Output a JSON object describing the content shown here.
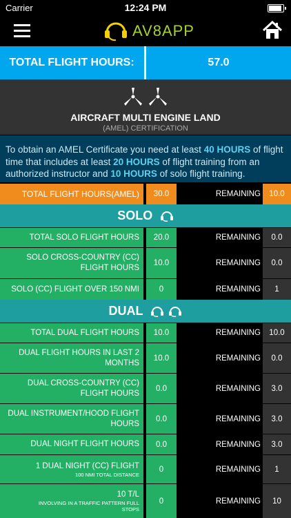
{
  "status": {
    "carrier": "Carrier",
    "time": "12:24 PM"
  },
  "app": {
    "title": "AV8APP"
  },
  "total": {
    "label": "TOTAL FLIGHT HOURS:",
    "value": "57.0"
  },
  "cert": {
    "title": "AIRCRAFT MULTI ENGINE LAND",
    "subtitle": "(AMEL) CERTIFICATION"
  },
  "desc": {
    "p1": "To obtain an AMEL Certificate you need at least ",
    "b1": "40 HOURS",
    "p2": " of flight time that includes at least ",
    "b2": "20 HOURS",
    "p3": " of flight training from an authorized instructor and ",
    "b3": "10 HOURS",
    "p4": " of solo flight training."
  },
  "amel": {
    "label": "TOTAL FLIGHT HOURS(AMEL)",
    "value": "30.0",
    "remaining_label": "REMAINING",
    "remaining": "10.0"
  },
  "solo": {
    "title": "SOLO",
    "rows": [
      {
        "label": "TOTAL SOLO FLIGHT HOURS",
        "value": "20.0",
        "remaining_label": "REMAINING",
        "remaining": "0.0"
      },
      {
        "label": "SOLO CROSS-COUNTRY (CC) FLIGHT HOURS",
        "value": "10.0",
        "remaining_label": "REMAINING",
        "remaining": "0.0"
      },
      {
        "label": "SOLO (CC) FLIGHT OVER 150 NMI",
        "value": "0",
        "remaining_label": "REMAINING",
        "remaining": "1"
      }
    ]
  },
  "dual": {
    "title": "DUAL",
    "rows": [
      {
        "label": "TOTAL DUAL FLIGHT HOURS",
        "value": "10.0",
        "remaining_label": "REMAINING",
        "remaining": "10.0"
      },
      {
        "label": "DUAL FLIGHT HOURS IN LAST 2 MONTHS",
        "value": "10.0",
        "remaining_label": "REMAINING",
        "remaining": "0.0"
      },
      {
        "label": "DUAL CROSS-COUNTRY (CC) FLIGHT HOURS",
        "value": "0.0",
        "remaining_label": "REMAINING",
        "remaining": "3.0"
      },
      {
        "label": "DUAL INSTRUMENT/HOOD FLIGHT HOURS",
        "value": "0.0",
        "remaining_label": "REMAINING",
        "remaining": "3.0"
      },
      {
        "label": "DUAL NIGHT FLIGHT HOURS",
        "value": "0.0",
        "remaining_label": "REMAINING",
        "remaining": "3.0"
      },
      {
        "label": "1 DUAL NIGHT (CC) FLIGHT",
        "sublabel": "100 NMI TOTAL DISTANCE",
        "value": "0",
        "remaining_label": "REMAINING",
        "remaining": "1"
      },
      {
        "label": "10 T/L",
        "sublabel": "INVOLVING IN A TRAFFIC PATTERN FULL STOPS",
        "value": "0",
        "remaining_label": "REMAINING",
        "remaining": "10"
      }
    ]
  },
  "icons": {
    "menu": "hamburger-menu-icon",
    "home": "home-icon",
    "logo": "headset-icon",
    "cert": "propeller-icon",
    "solo": "headset-icon",
    "dual": "headset-icon"
  },
  "colors": {
    "header_blue": "#00a7ee",
    "green": "#23b064",
    "orange": "#f08c1e",
    "teal": "#1f9ea0",
    "desc_bg": "#003e5b",
    "logo_green": "#a6d22a"
  }
}
